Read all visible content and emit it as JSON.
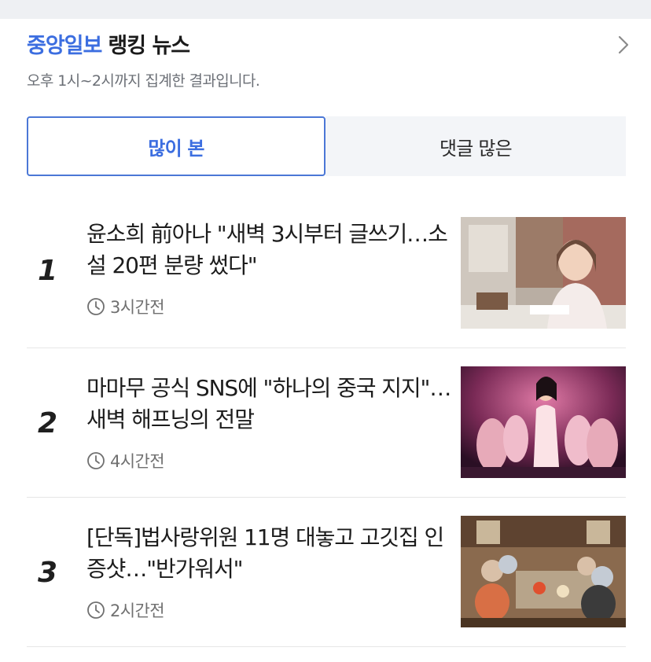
{
  "header": {
    "press": "중앙일보",
    "title": "랭킹 뉴스",
    "subtitle": "오후 1시~2시까지 집계한 결과입니다."
  },
  "tabs": [
    {
      "label": "많이 본",
      "selected": true
    },
    {
      "label": "댓글 많은",
      "selected": false
    }
  ],
  "items": [
    {
      "rank": "1",
      "headline": "윤소희 前아나 \"새벽 3시부터 글쓰기…소설 20편 분량 썼다\"",
      "time": "3시간전",
      "thumb_desc": "woman seated at desk"
    },
    {
      "rank": "2",
      "headline": "마마무 공식 SNS에 \"하나의 중국 지지\"…새벽 해프닝의 전말",
      "time": "4시간전",
      "thumb_desc": "stage performance with pink lights"
    },
    {
      "rank": "3",
      "headline": "[단독]법사랑위원 11명 대놓고 고깃집 인증샷…\"반가워서\"",
      "time": "2시간전",
      "thumb_desc": "group dining at restaurant"
    }
  ],
  "colors": {
    "accent": "#3c6ee0",
    "tab_border": "#4b77d6",
    "inactive_tab_bg": "#f3f5f8"
  },
  "icons": {
    "more": "chevron-right-icon",
    "time": "clock-icon"
  }
}
